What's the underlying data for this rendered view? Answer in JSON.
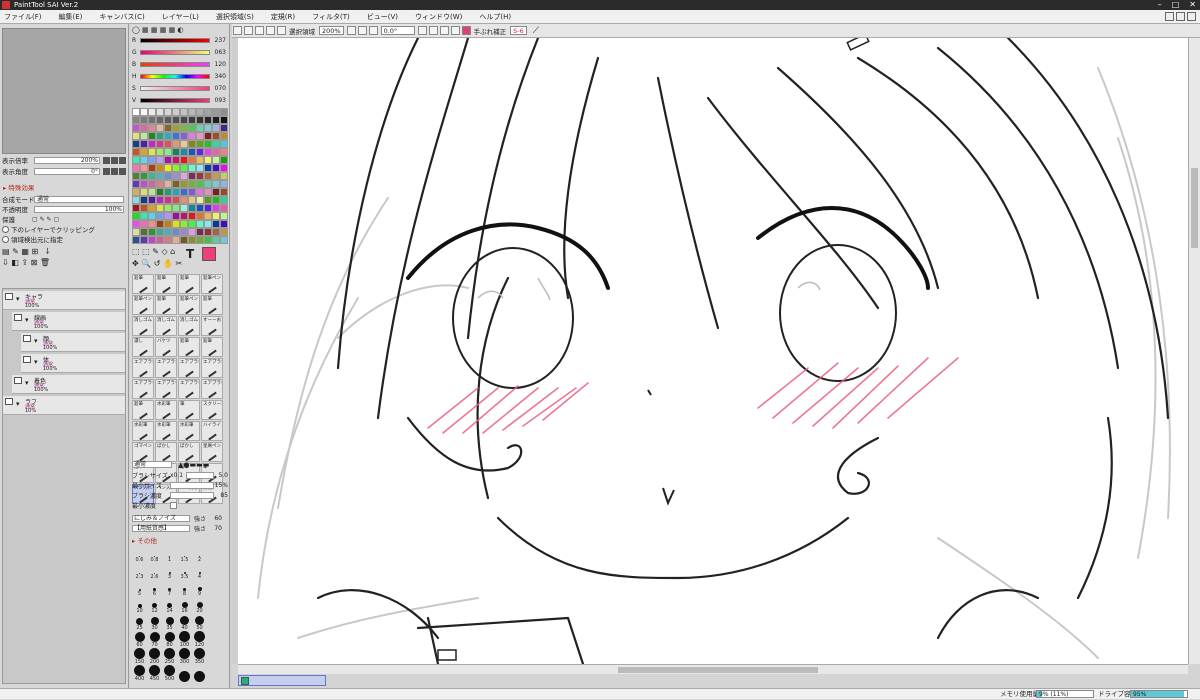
{
  "window": {
    "title": "PaintTool SAI Ver.2"
  },
  "menu": [
    "ファイル(F)",
    "編集(E)",
    "キャンバス(C)",
    "レイヤー(L)",
    "選択領域(S)",
    "定規(R)",
    "フィルタ(T)",
    "ビュー(V)",
    "ウィンドウ(W)",
    "ヘルプ(H)"
  ],
  "navigator": {
    "zoom_label": "表示倍率",
    "zoom_value": "200%",
    "angle_label": "表示角度",
    "angle_value": "0°"
  },
  "effects": {
    "header": "▸ 特殊効果"
  },
  "layer_props": {
    "blend_label": "合成モード",
    "blend_value": "通常",
    "opacity_label": "不透明度",
    "opacity_value": "100%",
    "protect_label": "保護",
    "clip_label": "下のレイヤーでクリッピング",
    "select_label": "領域検出元に指定"
  },
  "layers": [
    {
      "name": "キャラ",
      "mode": "通常",
      "opacity": "100%",
      "indent": 0
    },
    {
      "name": "線画",
      "mode": "通常",
      "opacity": "100%",
      "indent": 1
    },
    {
      "name": "顔",
      "mode": "通常",
      "opacity": "100%",
      "indent": 2
    },
    {
      "name": "体",
      "mode": "通常",
      "opacity": "100%",
      "indent": 2
    },
    {
      "name": "着色",
      "mode": "通常",
      "opacity": "100%",
      "indent": 1
    },
    {
      "name": "ラフ",
      "mode": "通常",
      "opacity": "10%",
      "indent": 0
    }
  ],
  "color_sliders": [
    {
      "ch": "R",
      "val": "237",
      "grad": "linear-gradient(90deg,#000,#f00)"
    },
    {
      "ch": "G",
      "val": "063",
      "grad": "linear-gradient(90deg,#ed0078,#edff78)"
    },
    {
      "ch": "B",
      "val": "120",
      "grad": "linear-gradient(90deg,#ed3f00,#ed3fff)"
    },
    {
      "ch": "H",
      "val": "340",
      "grad": "linear-gradient(90deg,#f00,#ff0,#0f0,#0ff,#00f,#f0f,#f00)"
    },
    {
      "ch": "S",
      "val": "070",
      "grad": "linear-gradient(90deg,#eee,#ed3f78)"
    },
    {
      "ch": "V",
      "val": "093",
      "grad": "linear-gradient(90deg,#000,#ed3f78)"
    }
  ],
  "current_color": "#ed3f78",
  "brushes": [
    "鉛筆",
    "鉛筆",
    "鉛筆",
    "鉛筆ペン",
    "鉛筆ペン",
    "鉛筆",
    "鉛筆ペン",
    "鉛筆",
    "消しゴム",
    "消しゴム",
    "消しゴム",
    "すーーお",
    "濃し",
    "バケツ",
    "鉛筆",
    "鉛筆",
    "エアブラシ",
    "エアブラシ",
    "エアブラシ",
    "エアブラシ",
    "エアブラシ",
    "エアブラシ",
    "エアブラシ",
    "エアブラシ",
    "鉛筆",
    "水彩筆",
    "筆",
    "スクリーン",
    "水彩筆",
    "水彩筆",
    "水彩筆",
    "ハイライト",
    "ゴマペン",
    "ぼかし",
    "ぼかし",
    "星屑ペン",
    "鉛筆",
    "ペン",
    "鉛筆",
    "筆",
    "ペン入れ",
    "ペン入れ",
    "ペン消し",
    "線幅"
  ],
  "brush_props": {
    "mode_value": "通常",
    "size_label": "ブラシサイズ",
    "size_mult": "x0.1",
    "size_value": "5.0",
    "minsize_label": "最小サイズ",
    "minsize_value": "15%",
    "density_label": "ブラシ濃度",
    "density_value": "85",
    "mindensity_label": "最小濃度",
    "tex1_value": "にじみ＆ノイズ",
    "tex1_strength_label": "強さ",
    "tex1_strength": "60",
    "tex2_value": "【用紙質感】",
    "tex2_strength_label": "強さ",
    "tex2_strength": "70",
    "other_header": "▸ その他"
  },
  "brush_sizes": [
    {
      "v": "0.6",
      "d": 1
    },
    {
      "v": "0.8",
      "d": 1
    },
    {
      "v": "1",
      "d": 1
    },
    {
      "v": "1.5",
      "d": 1
    },
    {
      "v": "2",
      "d": 1
    },
    {
      "v": "",
      "d": 0
    },
    {
      "v": "2.3",
      "d": 1
    },
    {
      "v": "2.6",
      "d": 1
    },
    {
      "v": "3",
      "d": 2
    },
    {
      "v": "3.5",
      "d": 2
    },
    {
      "v": "4",
      "d": 2
    },
    {
      "v": "",
      "d": 0
    },
    {
      "v": "5",
      "d": 2
    },
    {
      "v": "6",
      "d": 3
    },
    {
      "v": "7",
      "d": 3
    },
    {
      "v": "8",
      "d": 3
    },
    {
      "v": "9",
      "d": 4
    },
    {
      "v": "",
      "d": 0
    },
    {
      "v": "10",
      "d": 4
    },
    {
      "v": "12",
      "d": 5
    },
    {
      "v": "14",
      "d": 5
    },
    {
      "v": "16",
      "d": 6
    },
    {
      "v": "20",
      "d": 6
    },
    {
      "v": "",
      "d": 0
    },
    {
      "v": "25",
      "d": 7
    },
    {
      "v": "30",
      "d": 8
    },
    {
      "v": "35",
      "d": 8
    },
    {
      "v": "40",
      "d": 9
    },
    {
      "v": "50",
      "d": 9
    },
    {
      "v": "",
      "d": 0
    },
    {
      "v": "60",
      "d": 10
    },
    {
      "v": "70",
      "d": 10
    },
    {
      "v": "80",
      "d": 10
    },
    {
      "v": "100",
      "d": 11
    },
    {
      "v": "120",
      "d": 11
    },
    {
      "v": "",
      "d": 0
    },
    {
      "v": "150",
      "d": 11
    },
    {
      "v": "200",
      "d": 11
    },
    {
      "v": "250",
      "d": 11
    },
    {
      "v": "300",
      "d": 11
    },
    {
      "v": "350",
      "d": 11
    },
    {
      "v": "",
      "d": 0
    },
    {
      "v": "400",
      "d": 11
    },
    {
      "v": "450",
      "d": 11
    },
    {
      "v": "500",
      "d": 11
    },
    {
      "v": "",
      "d": 11
    },
    {
      "v": "",
      "d": 11
    },
    {
      "v": "",
      "d": 0
    }
  ],
  "canvas_toolbar": {
    "selection_label": "選択領域",
    "zoom_value": "200%",
    "angle_value": "0.0°",
    "stabilizer_label": "手ぶれ補正",
    "stabilizer_value": "S-6"
  },
  "status": {
    "memory_label": "メモリ使用量",
    "memory_value": "9% (11%)",
    "memory_fill": 0.09,
    "drive_label": "ドライブ容量",
    "drive_value": "95%",
    "drive_fill": 0.95
  }
}
